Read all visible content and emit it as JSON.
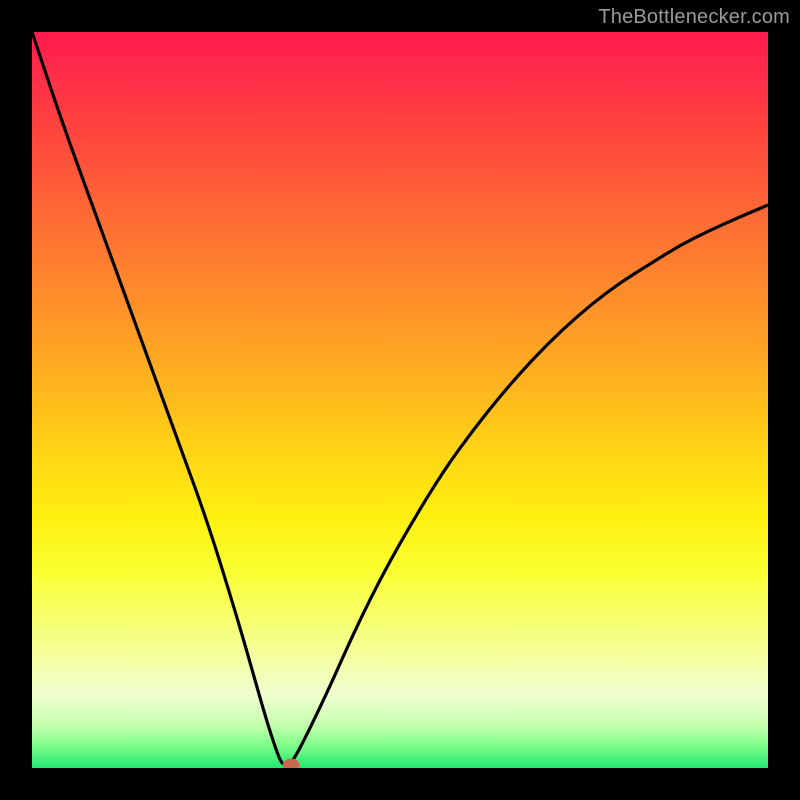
{
  "watermark": {
    "text": "TheBottlenecker.com"
  },
  "chart_data": {
    "type": "line",
    "title": "",
    "xlabel": "",
    "ylabel": "",
    "xlim": [
      0,
      100
    ],
    "ylim": [
      0,
      100
    ],
    "x": [
      0,
      4,
      8,
      12,
      16,
      20,
      24,
      28,
      30,
      32,
      33.5,
      34,
      34.5,
      35,
      36,
      40,
      44,
      48,
      52,
      56,
      60,
      64,
      68,
      72,
      76,
      80,
      84,
      88,
      92,
      96,
      100
    ],
    "values": [
      100,
      88,
      77,
      66,
      55,
      44,
      33,
      20,
      13,
      6,
      1.5,
      0.6,
      0.4,
      0.6,
      1.8,
      10,
      19,
      27,
      34,
      40.5,
      46,
      51,
      55.5,
      59.5,
      63,
      66,
      68.5,
      71,
      73,
      74.8,
      76.5
    ],
    "marker": {
      "x": 35.2,
      "y": 0.4
    },
    "background_gradient": {
      "stops": [
        {
          "pos": 0.0,
          "color": "#ff1a4d"
        },
        {
          "pos": 0.5,
          "color": "#ffbb1c"
        },
        {
          "pos": 0.8,
          "color": "#f8ff66"
        },
        {
          "pos": 1.0,
          "color": "#22e873"
        }
      ]
    }
  }
}
